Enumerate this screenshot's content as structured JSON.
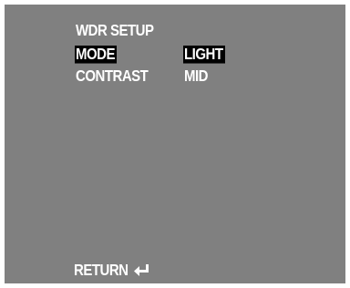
{
  "menu": {
    "title": "WDR SETUP",
    "items": [
      {
        "label": "MODE",
        "value": "LIGHT",
        "selected": true
      },
      {
        "label": "CONTRAST",
        "value": "MID",
        "selected": false
      }
    ]
  },
  "footer": {
    "return_label": "RETURN",
    "return_icon": "enter-arrow-icon"
  },
  "colors": {
    "background": "#808080",
    "text": "#ffffff",
    "highlight": "#000000"
  }
}
